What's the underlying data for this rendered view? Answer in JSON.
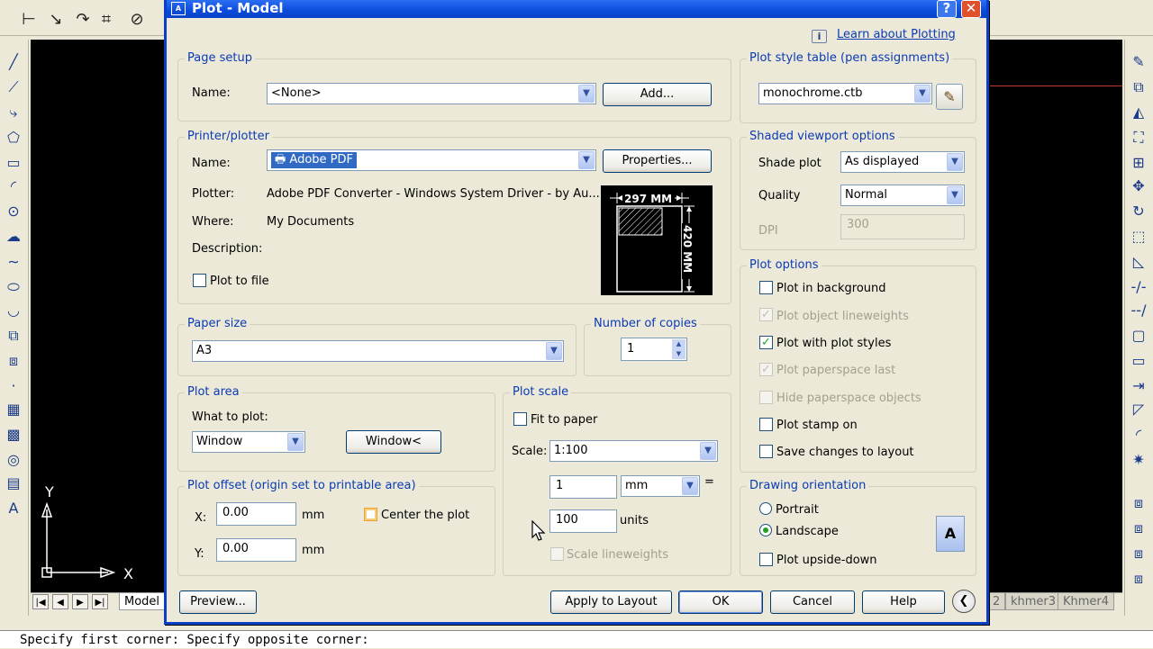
{
  "cad": {
    "layout_tabs": [
      "Model",
      "2",
      "khmer3",
      "Khmer4"
    ],
    "ucs_x_label": "X",
    "ucs_y_label": "Y",
    "command_line": "Specify first corner: Specify opposite corner:"
  },
  "dialog": {
    "title": "Plot - Model",
    "help_glyph": "?",
    "close_glyph": "✕",
    "learn_link": "Learn about Plotting",
    "page_setup": {
      "legend": "Page setup",
      "name_label": "Name:",
      "name_value": "<None>",
      "add_button": "Add..."
    },
    "printer": {
      "legend": "Printer/plotter",
      "name_label": "Name:",
      "name_value": "Adobe PDF",
      "properties_button": "Properties...",
      "plotter_label": "Plotter:",
      "plotter_value": "Adobe PDF Converter - Windows System Driver - by Au...",
      "where_label": "Where:",
      "where_value": "My Documents",
      "description_label": "Description:",
      "plot_to_file_label": "Plot to file",
      "plot_to_file_checked": false,
      "paper_width_label": "297 MM",
      "paper_height_label": "420 MM"
    },
    "paper_size": {
      "legend": "Paper size",
      "value": "A3"
    },
    "copies": {
      "legend": "Number of copies",
      "value": "1"
    },
    "plot_area": {
      "legend": "Plot area",
      "what_label": "What to plot:",
      "what_value": "Window",
      "window_button": "Window<"
    },
    "plot_offset": {
      "legend": "Plot offset (origin set to printable area)",
      "x_label": "X:",
      "x_value": "0.00",
      "y_label": "Y:",
      "y_value": "0.00",
      "unit": "mm",
      "center_label": "Center the plot",
      "center_checked": false
    },
    "plot_scale": {
      "legend": "Plot scale",
      "fit_label": "Fit to paper",
      "fit_checked": false,
      "scale_label": "Scale:",
      "scale_value": "1:100",
      "value1": "1",
      "unit_value": "mm",
      "equals": "=",
      "value2": "100",
      "units_label": "units",
      "lineweights_label": "Scale lineweights"
    },
    "plot_style": {
      "legend": "Plot style table (pen assignments)",
      "value": "monochrome.ctb"
    },
    "shaded": {
      "legend": "Shaded viewport options",
      "shade_label": "Shade plot",
      "shade_value": "As displayed",
      "quality_label": "Quality",
      "quality_value": "Normal",
      "dpi_label": "DPI",
      "dpi_value": "300"
    },
    "plot_options": {
      "legend": "Plot options",
      "items": [
        {
          "label": "Plot in background",
          "checked": false,
          "enabled": true
        },
        {
          "label": "Plot object lineweights",
          "checked": true,
          "enabled": false
        },
        {
          "label": "Plot with plot styles",
          "checked": true,
          "enabled": true
        },
        {
          "label": "Plot paperspace last",
          "checked": true,
          "enabled": false
        },
        {
          "label": "Hide paperspace objects",
          "checked": false,
          "enabled": false
        },
        {
          "label": "Plot stamp on",
          "checked": false,
          "enabled": true
        },
        {
          "label": "Save changes to layout",
          "checked": false,
          "enabled": true
        }
      ]
    },
    "orientation": {
      "legend": "Drawing orientation",
      "portrait_label": "Portrait",
      "landscape_label": "Landscape",
      "selected": "Landscape",
      "upside_label": "Plot upside-down",
      "upside_checked": false,
      "preview_glyph": "A"
    },
    "buttons": {
      "preview": "Preview...",
      "apply": "Apply to Layout",
      "ok": "OK",
      "cancel": "Cancel",
      "help": "Help"
    },
    "colors": {
      "title_bar": "#0a4bdc",
      "group_label": "#0b3bb5",
      "check_mark": "#21a121"
    }
  }
}
